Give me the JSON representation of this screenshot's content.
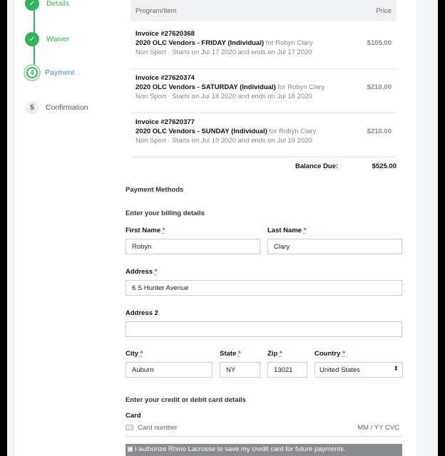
{
  "stepper": {
    "items": [
      {
        "num": "✓",
        "label": "Details",
        "state": "done"
      },
      {
        "num": "✓",
        "label": "Waiver",
        "state": "done"
      },
      {
        "num": "4",
        "label": "Payment",
        "state": "current"
      },
      {
        "num": "5",
        "label": "Confirmation",
        "state": "todo"
      }
    ]
  },
  "table": {
    "headers": {
      "item": "Program/Item",
      "price": "Price"
    },
    "rows": [
      {
        "invoice": "Invoice #27620368",
        "name": "2020 OLC Vendors - FRIDAY (Individual)",
        "for": " for Robyn Clary",
        "meta": "Non Sport · Starts on Jul 17 2020 and ends on Jul 17 2020",
        "price": "$105.00"
      },
      {
        "invoice": "Invoice #27620374",
        "name": "2020 OLC Vendors - SATURDAY (Individual)",
        "for": " for Robyn Clary",
        "meta": "Non Sport · Starts on Jul 18 2020 and ends on Jul 18 2020",
        "price": "$210.00"
      },
      {
        "invoice": "Invoice #27620377",
        "name": "2020 OLC Vendors - SUNDAY (Individual)",
        "for": " for Robyn Clary",
        "meta": "Non Sport · Starts on Jul 19 2020 and ends on Jul 19 2020",
        "price": "$210.00"
      }
    ],
    "balance_label": "Balance Due:",
    "balance_value": "$525.00"
  },
  "payment": {
    "methods_heading": "Payment Methods",
    "billing_heading": "Enter your billing details",
    "first_name_label": "First Name",
    "first_name_value": "Robyn",
    "last_name_label": "Last Name",
    "last_name_value": "Clary",
    "address_label": "Address",
    "address_value": "6 S Hunter Avenue",
    "address2_label": "Address 2",
    "address2_value": "",
    "city_label": "City",
    "city_value": "Auburn",
    "state_label": "State",
    "state_value": "NY",
    "zip_label": "Zip",
    "zip_value": "13021",
    "country_label": "Country",
    "country_value": "United States",
    "required_mark": "*",
    "card_heading": "Enter your credit or debit card details",
    "card_label": "Card",
    "card_placeholder": "Card number",
    "card_expiry_placeholder": "MM / YY  CVC",
    "authorize_text": "I authorize Rhino Lacrosse to save my credit card for future payments."
  },
  "icons": {
    "step_done": "check-icon",
    "select_arrow": "updown-chevron-icon",
    "card": "credit-card-icon"
  },
  "colors": {
    "accent_green": "#34b45a",
    "accent_blue": "#4a86c5",
    "required_red": "#d9353a"
  }
}
